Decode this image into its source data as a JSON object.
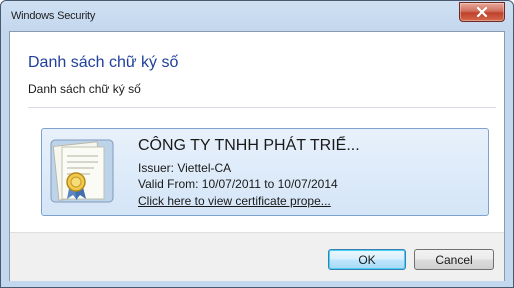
{
  "window": {
    "title": "Windows Security"
  },
  "dialog": {
    "heading": "Danh sách chữ ký số",
    "subheading": "Danh sách chữ ký số"
  },
  "certificate": {
    "name": "CÔNG TY TNHH PHÁT TRIỂ...",
    "issuer": "Issuer: Viettel-CA",
    "valid": "Valid From: 10/07/2011 to 10/07/2014",
    "link": "Click here to view certificate prope...",
    "icon": "certificate-icon"
  },
  "buttons": {
    "ok": "OK",
    "cancel": "Cancel"
  },
  "colors": {
    "heading": "#1f3f9b",
    "selection_border": "#7da2ce",
    "selection_bg": "#d4e5f7",
    "close_red": "#c0412b"
  }
}
